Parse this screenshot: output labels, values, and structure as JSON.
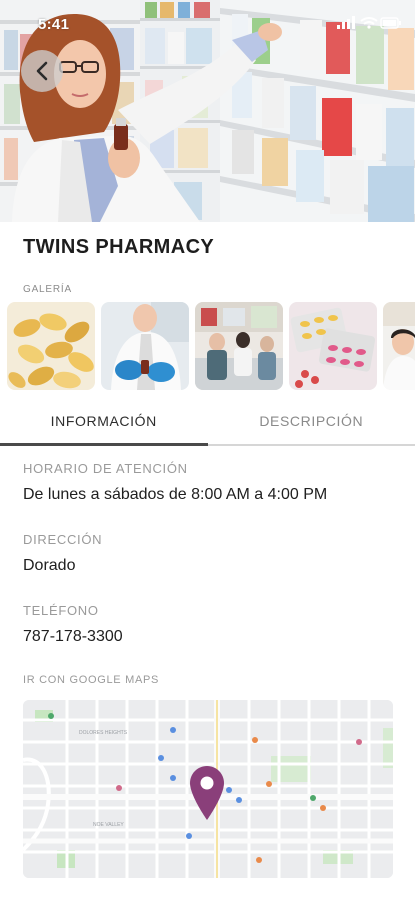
{
  "status_bar": {
    "time": "5:41"
  },
  "header": {
    "title": "TWINS PHARMACY"
  },
  "gallery": {
    "label": "GALERÍA"
  },
  "tabs": [
    {
      "label": "INFORMACIÓN",
      "active": true
    },
    {
      "label": "DESCRIPCIÓN",
      "active": false
    }
  ],
  "info": {
    "hours_label": "HORARIO DE ATENCIÓN",
    "hours_value": "De lunes a sábados de 8:00 AM a 4:00 PM",
    "address_label": "DIRECCIÓN",
    "address_value": "Dorado",
    "phone_label": "TELÉFONO",
    "phone_value": "787-178-3300"
  },
  "maps": {
    "label": "IR CON GOOGLE MAPS",
    "place_labels": [
      "DOLORES HEIGHTS",
      "NOE VALLEY"
    ]
  },
  "colors": {
    "accent": "#8a3f7a",
    "tab_active_underline": "#4a4a4a",
    "tab_inactive_underline": "#d6d6d6"
  }
}
